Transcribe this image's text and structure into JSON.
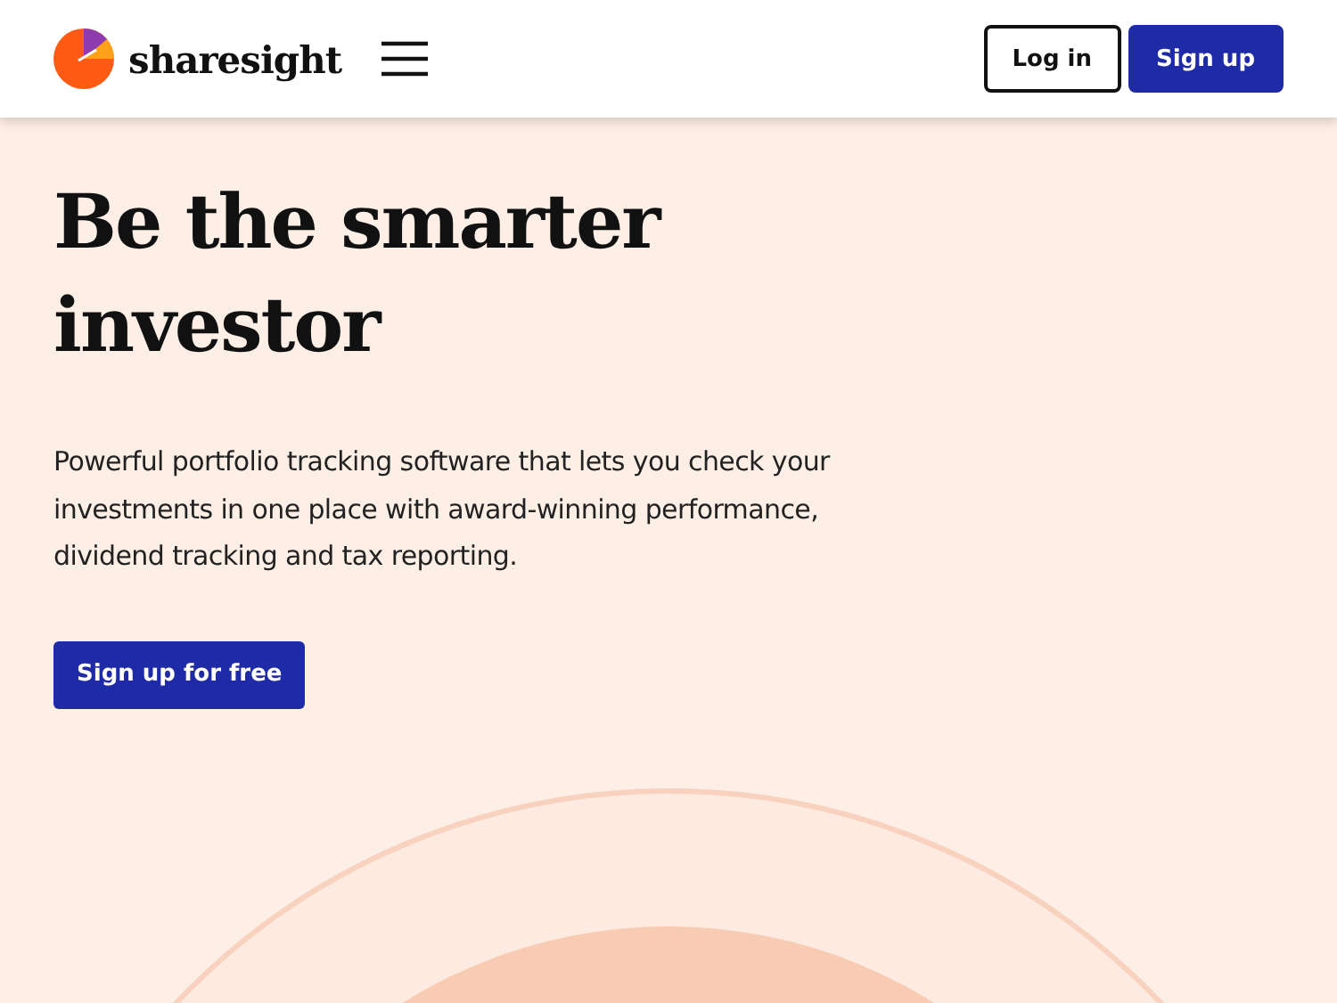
{
  "header": {
    "brand": "sharesight",
    "buttons": [
      {
        "label": "Log in",
        "kind": "outline"
      },
      {
        "label": "Sign up",
        "kind": "solid"
      }
    ]
  },
  "hero": {
    "title_lines": [
      "Be the smarter",
      "investor"
    ],
    "text": "Powerful portfolio tracking software that lets you check your investments in one place with award-winning performance, dividend tracking and tax reporting.",
    "cta": "Sign up for free"
  }
}
